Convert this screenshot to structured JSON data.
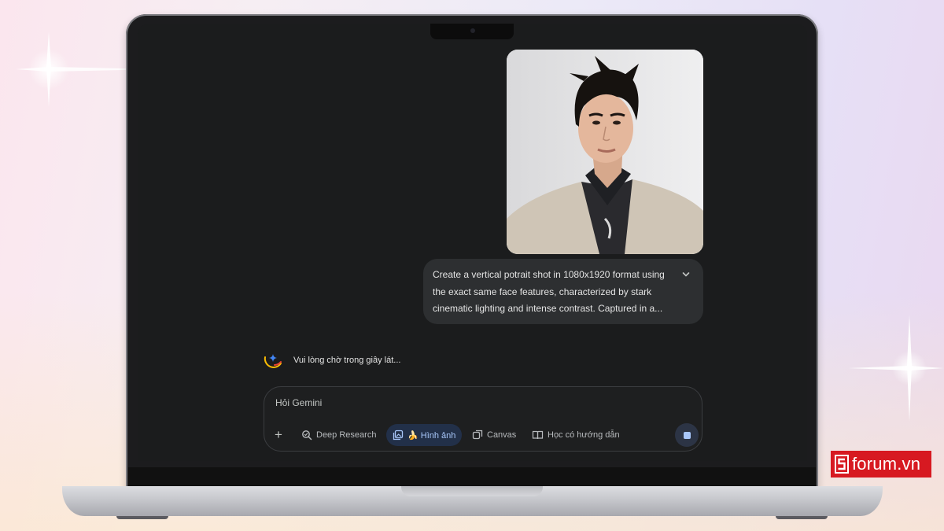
{
  "chat": {
    "user_prompt": "Create a vertical potrait shot in 1080x1920 format using the exact same face features, characterized by stark cinematic lighting and intense contrast. Captured in a...",
    "status": "Vui lòng chờ trong giây lát..."
  },
  "composer": {
    "placeholder": "Hỏi Gemini",
    "tools": {
      "add": "+",
      "deep_research": "Deep Research",
      "image": "🍌 Hình ảnh",
      "canvas": "Canvas",
      "guided_learning": "Học có hướng dẫn"
    }
  },
  "watermark": {
    "site": "forum.vn"
  },
  "colors": {
    "accent": "#a8c7fa",
    "bubble": "#2d2f31",
    "screen": "#1b1c1d",
    "brand": "#d71921"
  }
}
